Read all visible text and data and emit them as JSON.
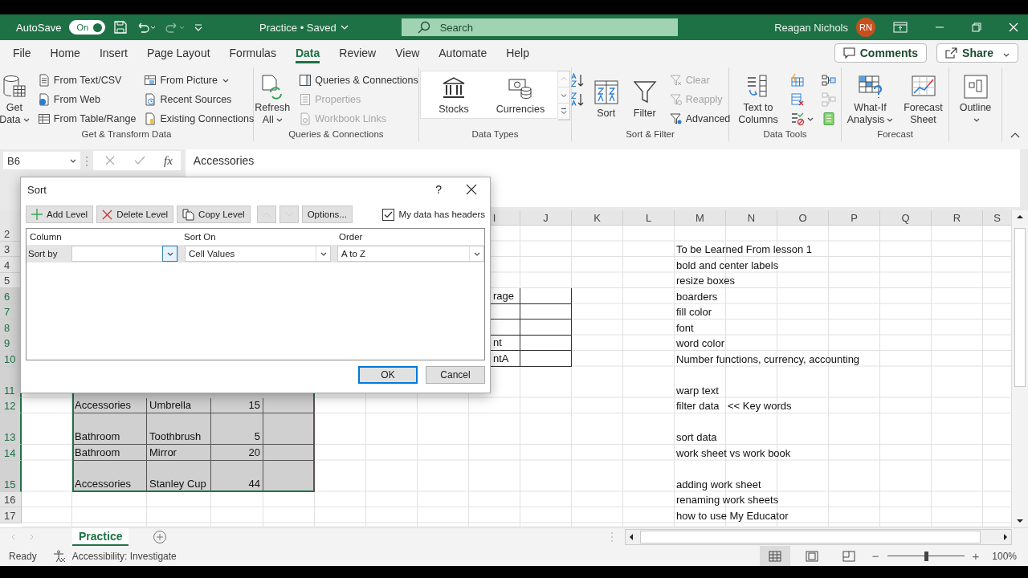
{
  "title_bar": {
    "autosave_label": "AutoSave",
    "autosave": {
      "label": "On",
      "on": true
    },
    "document_title": "Practice • Saved",
    "search": {
      "placeholder": "Search"
    },
    "user_name": "Reagan Nichols",
    "avatar_initials": "RN"
  },
  "tabs": [
    {
      "label": "File",
      "selected": false
    },
    {
      "label": "Home",
      "selected": false
    },
    {
      "label": "Insert",
      "selected": false
    },
    {
      "label": "Page Layout",
      "selected": false
    },
    {
      "label": "Formulas",
      "selected": false
    },
    {
      "label": "Data",
      "selected": true
    },
    {
      "label": "Review",
      "selected": false
    },
    {
      "label": "View",
      "selected": false
    },
    {
      "label": "Automate",
      "selected": false
    },
    {
      "label": "Help",
      "selected": false
    }
  ],
  "header_buttons": [
    {
      "label": "Comments",
      "kind": "comments"
    },
    {
      "label": "Share",
      "kind": "share"
    }
  ],
  "ribbon": [
    {
      "title": "Get & Transform Data",
      "items": [
        {
          "label": "Get Data",
          "kind": "large",
          "disabled": false,
          "dropdown": true
        },
        {
          "label": "From Text/CSV",
          "kind": "small",
          "disabled": false,
          "dropdown": false
        },
        {
          "label": "From Web",
          "kind": "small",
          "disabled": false,
          "dropdown": false
        },
        {
          "label": "From Table/Range",
          "kind": "small",
          "disabled": false,
          "dropdown": false
        },
        {
          "label": "From Picture",
          "kind": "small",
          "disabled": false,
          "dropdown": true
        },
        {
          "label": "Recent Sources",
          "kind": "small",
          "disabled": false,
          "dropdown": false
        },
        {
          "label": "Existing Connections",
          "kind": "small",
          "disabled": false,
          "dropdown": false
        }
      ]
    },
    {
      "title": "Queries & Connections",
      "items": [
        {
          "label": "Refresh All",
          "kind": "large",
          "disabled": false,
          "dropdown": true
        },
        {
          "label": "Queries & Connections",
          "kind": "small",
          "disabled": false,
          "dropdown": false
        },
        {
          "label": "Properties",
          "kind": "small",
          "disabled": true,
          "dropdown": false
        },
        {
          "label": "Workbook Links",
          "kind": "small",
          "disabled": true,
          "dropdown": false
        }
      ]
    },
    {
      "title": "Data Types",
      "items": [
        {
          "label": "Stocks",
          "kind": "large",
          "disabled": false,
          "dropdown": false
        },
        {
          "label": "Currencies",
          "kind": "large",
          "disabled": false,
          "dropdown": false
        }
      ]
    },
    {
      "title": "Sort & Filter",
      "items": [
        {
          "kind": "icon",
          "disabled": false,
          "dropdown": false
        },
        {
          "kind": "icon",
          "disabled": false,
          "dropdown": false
        },
        {
          "label": "Sort",
          "kind": "large",
          "disabled": false,
          "dropdown": false
        },
        {
          "label": "Filter",
          "kind": "large",
          "disabled": false,
          "dropdown": false
        },
        {
          "label": "Clear",
          "kind": "small",
          "disabled": true,
          "dropdown": false
        },
        {
          "label": "Reapply",
          "kind": "small",
          "disabled": true,
          "dropdown": false
        },
        {
          "label": "Advanced",
          "kind": "small",
          "disabled": false,
          "dropdown": false
        }
      ]
    },
    {
      "title": "Data Tools",
      "items": [
        {
          "label": "Text to Columns",
          "kind": "large",
          "disabled": false,
          "dropdown": false
        },
        {
          "kind": "icon",
          "disabled": false,
          "dropdown": false
        },
        {
          "kind": "icon",
          "disabled": false,
          "dropdown": false
        },
        {
          "kind": "icon",
          "disabled": false,
          "dropdown": true
        },
        {
          "kind": "icon",
          "disabled": false,
          "dropdown": false
        },
        {
          "kind": "icon",
          "disabled": true,
          "dropdown": false
        },
        {
          "kind": "icon",
          "disabled": false,
          "dropdown": false
        }
      ]
    },
    {
      "title": "Forecast",
      "items": [
        {
          "label": "What-If Analysis",
          "kind": "large",
          "disabled": false,
          "dropdown": true
        },
        {
          "label": "Forecast Sheet",
          "kind": "large",
          "disabled": false,
          "dropdown": false
        }
      ]
    },
    {
      "items": [
        {
          "label": "Outline",
          "kind": "large",
          "disabled": false,
          "dropdown": true
        }
      ]
    }
  ],
  "formula_bar": {
    "name_box": "B6",
    "function_label": "fx",
    "value": "Accessories"
  },
  "column_headers": [
    {
      "label": "I"
    },
    {
      "label": "J"
    },
    {
      "label": "K"
    },
    {
      "label": "L"
    },
    {
      "label": "M"
    },
    {
      "label": "N"
    },
    {
      "label": "O"
    },
    {
      "label": "P"
    },
    {
      "label": "Q"
    },
    {
      "label": "R"
    },
    {
      "label": "S"
    }
  ],
  "row_headers": [
    {
      "label": "2",
      "selected": false
    },
    {
      "label": "3",
      "selected": false
    },
    {
      "label": "4",
      "selected": false
    },
    {
      "label": "5",
      "selected": false
    },
    {
      "label": "6",
      "selected": true
    },
    {
      "label": "7",
      "selected": true
    },
    {
      "label": "8",
      "selected": true
    },
    {
      "label": "9",
      "selected": true
    },
    {
      "label": "10",
      "selected": true
    },
    {
      "label": "11",
      "selected": true
    },
    {
      "label": "12",
      "selected": true
    },
    {
      "label": "13",
      "selected": true
    },
    {
      "label": "14",
      "selected": true
    },
    {
      "label": "15",
      "selected": true
    },
    {
      "label": "16",
      "selected": false
    },
    {
      "label": "17",
      "selected": false
    }
  ],
  "column_i": [
    {
      "text": "rage",
      "bordered": true
    },
    {
      "bordered": true
    },
    {
      "bordered": true
    },
    {
      "text": "nt",
      "bordered": true
    },
    {
      "text": "ntA",
      "bordered": true
    }
  ],
  "table_rows": [
    {
      "cells": [
        {
          "text": "Accessories",
          "kind": "text"
        },
        {
          "text": "Umbrella",
          "kind": "text"
        },
        {
          "text": "15",
          "kind": "number"
        }
      ]
    },
    {
      "cells": [
        {
          "text": "Bathroom",
          "kind": "text"
        },
        {
          "text": "Toothbrush",
          "kind": "text"
        },
        {
          "text": "5",
          "kind": "number"
        }
      ]
    },
    {
      "cells": [
        {
          "text": "Bathroom",
          "kind": "text"
        },
        {
          "text": "Mirror",
          "kind": "text"
        },
        {
          "text": "20",
          "kind": "number"
        }
      ]
    },
    {
      "cells": [
        {
          "text": "Accessories",
          "kind": "text"
        },
        {
          "text": "Stanley Cup",
          "kind": "text"
        },
        {
          "text": "44",
          "kind": "number"
        }
      ]
    }
  ],
  "notes": [
    {
      "text": "To be Learned From lesson 1"
    },
    {
      "text": "bold and center labels"
    },
    {
      "text": "resize boxes"
    },
    {
      "text": "boarders"
    },
    {
      "text": "fill color"
    },
    {
      "text": "font"
    },
    {
      "text": "word color"
    },
    {
      "text": "Number functions, currency, accounting"
    },
    {
      "text": "warp text"
    },
    {
      "text": "filter data",
      "next_cell": "<< Key words"
    },
    {
      "text": "sort data"
    },
    {
      "text": "work sheet vs work book"
    },
    {
      "text": "adding work sheet"
    },
    {
      "text": "renaming work sheets"
    },
    {
      "text": "how to use My Educator"
    }
  ],
  "sort_dialog": {
    "title": "Sort",
    "help": "?",
    "toolbar": [
      {
        "label": "Add Level",
        "kind": "add",
        "disabled": false
      },
      {
        "label": "Delete Level",
        "kind": "delete",
        "disabled": false
      },
      {
        "label": "Copy Level",
        "kind": "copy",
        "disabled": false
      },
      {
        "kind": "up",
        "disabled": true
      },
      {
        "kind": "down",
        "disabled": true
      },
      {
        "label": "Options...",
        "kind": "options",
        "disabled": false
      }
    ],
    "headers_checkbox": {
      "label": "My data has headers",
      "checked": true
    },
    "columns": [
      "Column",
      "Sort On",
      "Order"
    ],
    "levels": [
      {
        "label": "Sort by",
        "sort_on": "Cell Values",
        "order": "A to Z",
        "selected": true
      }
    ],
    "buttons": [
      {
        "label": "OK",
        "default": true
      },
      {
        "label": "Cancel",
        "default": false
      }
    ]
  },
  "sheet_tabs": [
    {
      "label": "Practice",
      "selected": true
    }
  ],
  "status_bar": {
    "status": "Ready",
    "accessibility": "Accessibility: Investigate",
    "views": [
      {
        "selected": true
      },
      {
        "selected": false
      },
      {
        "selected": false
      }
    ],
    "zoom": {
      "out_label": "−",
      "in_label": "+",
      "level": 0.5,
      "reading": "100%"
    }
  }
}
